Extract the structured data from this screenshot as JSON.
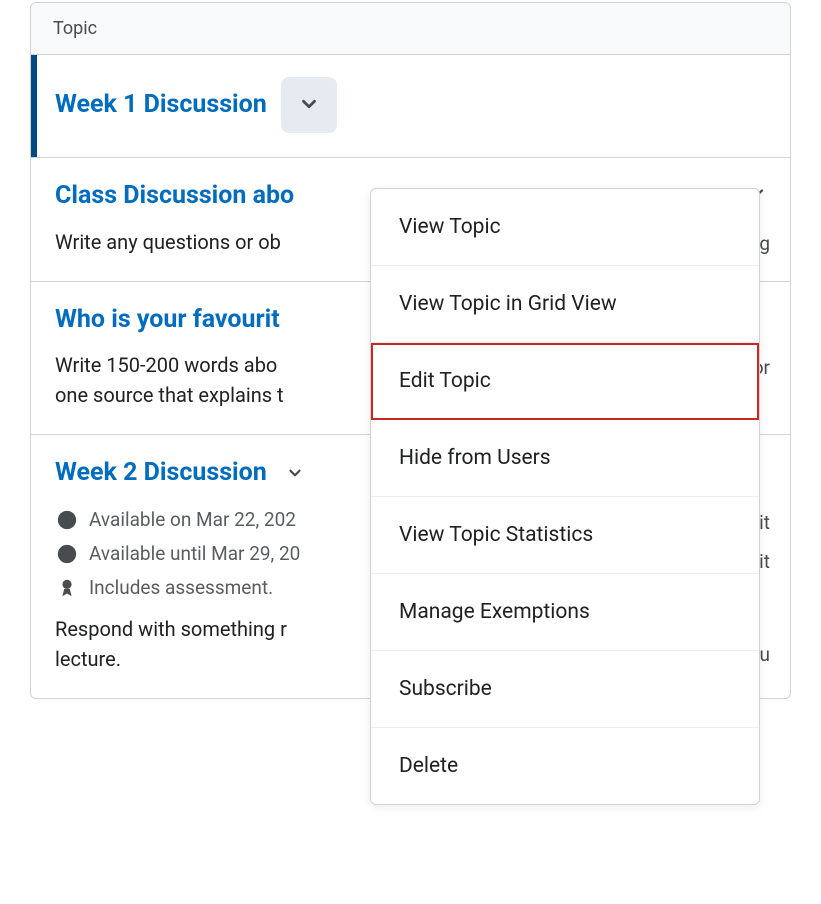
{
  "panel_header": "Topic",
  "topics": [
    {
      "title": "Week 1 Discussion",
      "selected": true
    },
    {
      "title": "Class Discussion abo",
      "desc": "Write any questions or ob",
      "right_cut_text": "nding"
    },
    {
      "title": "Who is your favourit",
      "desc": "Write 150-200 words abo",
      "desc_cont": "one source that explains t",
      "right_cut_text": "ronor"
    },
    {
      "title": "Week 2 Discussion",
      "avail_on": "Available on Mar 22, 202",
      "avail_until": "Available until Mar 29, 20",
      "assess": "Includes assessment.",
      "desc": "Respond with something r",
      "desc_cont": "lecture.",
      "right_cut_avail1": "labilit",
      "right_cut_avail2": "labilit",
      "right_cut_desc": "you"
    }
  ],
  "menu": {
    "view_topic": "View Topic",
    "view_grid": "View Topic in Grid View",
    "edit_topic": "Edit Topic",
    "hide": "Hide from Users",
    "stats": "View Topic Statistics",
    "exemptions": "Manage Exemptions",
    "subscribe": "Subscribe",
    "delete": "Delete"
  }
}
